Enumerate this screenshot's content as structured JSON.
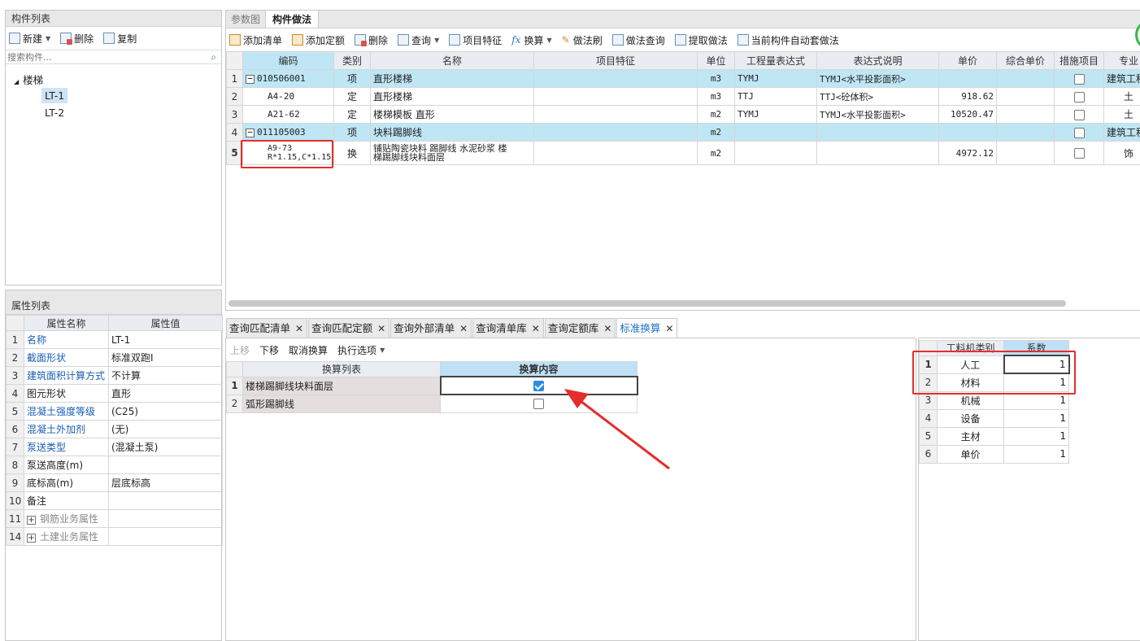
{
  "left_top": {
    "title": "构件列表",
    "toolbar": {
      "new": "新建",
      "delete": "删除",
      "copy": "复制"
    },
    "search_placeholder": "搜索构件...",
    "tree": {
      "root": "楼梯",
      "items": [
        "LT-1",
        "LT-2"
      ]
    }
  },
  "props": {
    "title": "属性列表",
    "headers": {
      "name": "属性名称",
      "value": "属性值"
    },
    "rows": [
      {
        "n": "1",
        "name": "名称",
        "value": "LT-1"
      },
      {
        "n": "2",
        "name": "截面形状",
        "value": "标准双跑I"
      },
      {
        "n": "3",
        "name": "建筑面积计算方式",
        "value": "不计算"
      },
      {
        "n": "4",
        "name": "图元形状",
        "value": "直形"
      },
      {
        "n": "5",
        "name": "混凝土强度等级",
        "value": "(C25)"
      },
      {
        "n": "6",
        "name": "混凝土外加剂",
        "value": "(无)"
      },
      {
        "n": "7",
        "name": "泵送类型",
        "value": "(混凝土泵)"
      },
      {
        "n": "8",
        "name": "泵送高度(m)",
        "value": ""
      },
      {
        "n": "9",
        "name": "底标高(m)",
        "value": "层底标高"
      },
      {
        "n": "10",
        "name": "备注",
        "value": ""
      },
      {
        "n": "11",
        "name": "钢筋业务属性",
        "value": ""
      },
      {
        "n": "14",
        "name": "土建业务属性",
        "value": ""
      }
    ]
  },
  "main": {
    "tabs": [
      "参数图",
      "构件做法"
    ],
    "toolbar": [
      "添加清单",
      "添加定额",
      "删除",
      "查询",
      "项目特征",
      "换算",
      "做法刷",
      "做法查询",
      "提取做法",
      "当前构件自动套做法"
    ],
    "headers": [
      "编码",
      "类别",
      "名称",
      "项目特征",
      "单位",
      "工程量表达式",
      "表达式说明",
      "单价",
      "综合单价",
      "措施项目",
      "专业"
    ],
    "rows": [
      {
        "n": "1",
        "code": "010506001",
        "type": "项",
        "name": "直形楼梯",
        "unit": "m3",
        "expr": "TYMJ",
        "desc": "TYMJ<水平投影面积>",
        "price": "",
        "spec": "建筑工程"
      },
      {
        "n": "2",
        "code": "A4-20",
        "type": "定",
        "name": "直形楼梯",
        "unit": "m3",
        "expr": "TTJ",
        "desc": "TTJ<砼体积>",
        "price": "918.62",
        "spec": "土"
      },
      {
        "n": "3",
        "code": "A21-62",
        "type": "定",
        "name": "楼梯模板 直形",
        "unit": "m2",
        "expr": "TYMJ",
        "desc": "TYMJ<水平投影面积>",
        "price": "10520.47",
        "spec": "土"
      },
      {
        "n": "4",
        "code": "011105003",
        "type": "项",
        "name": "块料踢脚线",
        "unit": "m2",
        "expr": "",
        "desc": "",
        "price": "",
        "spec": "建筑工程"
      },
      {
        "n": "5",
        "code": "A9-73",
        "code2": "R*1.15,C*1.15",
        "type": "换",
        "name": "铺贴陶瓷块料 踢脚线 水泥砂浆  楼",
        "name2": "梯踢脚线块料面层",
        "unit": "m2",
        "expr": "",
        "desc": "",
        "price": "4972.12",
        "spec": "饰"
      }
    ]
  },
  "bottom": {
    "tabs": [
      "查询匹配清单",
      "查询匹配定额",
      "查询外部清单",
      "查询清单库",
      "查询定额库",
      "标准换算"
    ],
    "toolbar": {
      "up": "上移",
      "down": "下移",
      "cancel": "取消换算",
      "exec": "执行选项"
    },
    "headers": {
      "list": "换算列表",
      "content": "换算内容"
    },
    "rows": [
      {
        "n": "1",
        "name": "楼梯踢脚线块料面层",
        "checked": true
      },
      {
        "n": "2",
        "name": "弧形踢脚线",
        "checked": false
      }
    ],
    "coef": {
      "headers": {
        "cat": "工料机类别",
        "coef": "系数"
      },
      "rows": [
        {
          "n": "1",
          "cat": "人工",
          "v": "1"
        },
        {
          "n": "2",
          "cat": "材料",
          "v": "1"
        },
        {
          "n": "3",
          "cat": "机械",
          "v": "1"
        },
        {
          "n": "4",
          "cat": "设备",
          "v": "1"
        },
        {
          "n": "5",
          "cat": "主材",
          "v": "1"
        },
        {
          "n": "6",
          "cat": "单价",
          "v": "1"
        }
      ]
    }
  },
  "colors": {
    "accent": "#1a73c8",
    "highlight": "#bfe6f5",
    "annotation": "#e52d2d"
  }
}
